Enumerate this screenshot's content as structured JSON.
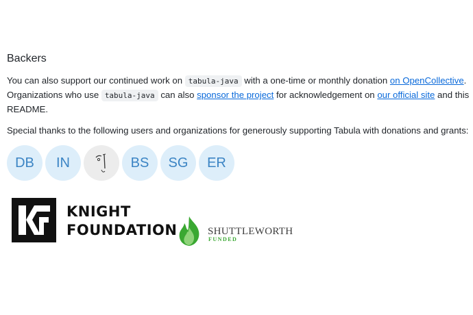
{
  "section": {
    "title": "Backers"
  },
  "paragraph1": {
    "t1": "You can also support our continued work on ",
    "code1": "tabula-java",
    "t2": " with a one-time or monthly donation ",
    "link_opencollective": "on OpenCollective",
    "t3": ".",
    "t4": "Organizations who use ",
    "code2": "tabula-java",
    "t5": " can also ",
    "link_sponsor": "sponsor the project",
    "t6": " for acknowledgement on ",
    "link_site": "our official site",
    "t7": " and this",
    "t8": "README."
  },
  "paragraph2": {
    "text": "Special thanks to the following users and organizations for generously supporting Tabula with donations and grants:"
  },
  "avatars": [
    {
      "initials": "DB"
    },
    {
      "initials": "IN"
    },
    {
      "initials": ""
    },
    {
      "initials": "BS"
    },
    {
      "initials": "SG"
    },
    {
      "initials": "ER"
    }
  ],
  "colors": {
    "link": "#0969da",
    "avatar_bg": "#ddeefa",
    "avatar_text": "#3b84c4",
    "code_bg": "#eff1f3"
  },
  "sponsors": {
    "knight": {
      "line1": "KNIGHT",
      "line2": "FOUNDATION",
      "logo_icon": "kf-logo"
    },
    "shuttleworth": {
      "name": "SHUTTLEWORTH",
      "sub": "FUNDED",
      "logo_icon": "flame-logo"
    }
  }
}
